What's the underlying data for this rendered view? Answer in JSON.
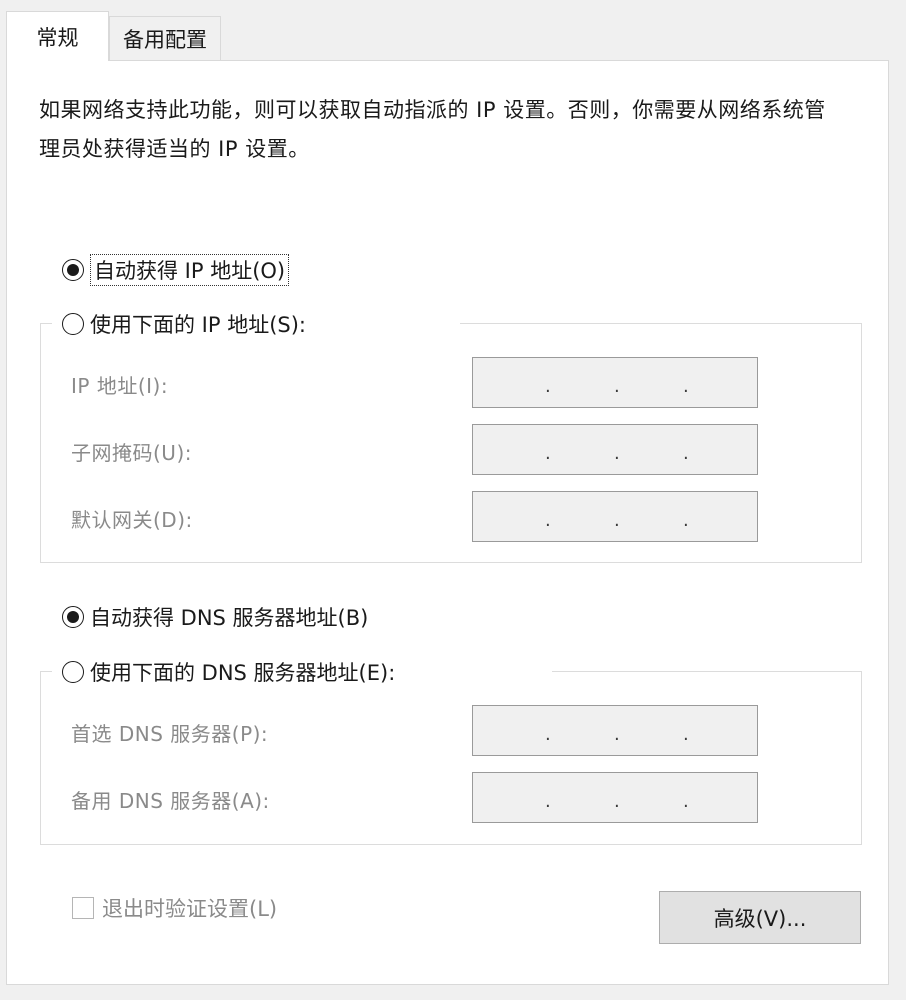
{
  "tabs": [
    {
      "label": "常规",
      "active": true
    },
    {
      "label": "备用配置",
      "active": false
    }
  ],
  "description": "如果网络支持此功能，则可以获取自动指派的 IP 设置。否则，你需要从网络系统管理员处获得适当的 IP 设置。",
  "ip_section": {
    "auto_option": {
      "label": "自动获得 IP 地址(O)",
      "selected": true
    },
    "manual_option": {
      "label": "使用下面的 IP 地址(S):",
      "selected": false
    },
    "fields": [
      {
        "label": "IP 地址(I):",
        "value": ". . ."
      },
      {
        "label": "子网掩码(U):",
        "value": ". . ."
      },
      {
        "label": "默认网关(D):",
        "value": ". . ."
      }
    ]
  },
  "dns_section": {
    "auto_option": {
      "label": "自动获得 DNS 服务器地址(B)",
      "selected": true
    },
    "manual_option": {
      "label": "使用下面的 DNS 服务器地址(E):",
      "selected": false
    },
    "fields": [
      {
        "label": "首选 DNS 服务器(P):",
        "value": ". . ."
      },
      {
        "label": "备用 DNS 服务器(A):",
        "value": ". . ."
      }
    ]
  },
  "validate_checkbox": {
    "label": "退出时验证设置(L)",
    "checked": false
  },
  "advanced_button": {
    "label": "高级(V)..."
  },
  "colors": {
    "window_bg": "#f0f0f0",
    "panel_bg": "#ffffff",
    "disabled_text": "#8a8a8a"
  }
}
